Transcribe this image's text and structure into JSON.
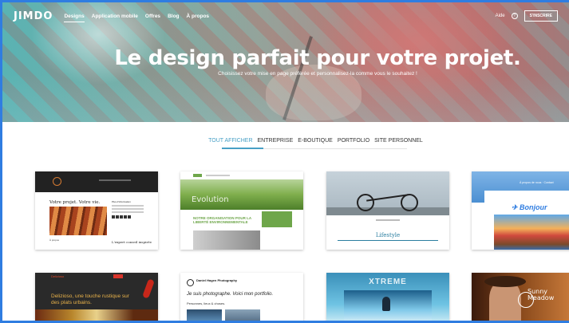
{
  "nav": {
    "logo": "JIMDO",
    "links": [
      "Designs",
      "Application mobile",
      "Offres",
      "Blog",
      "À propos"
    ],
    "help": "Aide",
    "signup": "S'INSCRIRE"
  },
  "hero": {
    "title": "Le design parfait pour votre projet.",
    "subtitle": "Choisissez votre mise en page préférée et personnalisez-la comme vous le souhaitez !"
  },
  "filters": [
    "TOUT AFFICHER",
    "ENTREPRISE",
    "E-BOUTIQUE",
    "PORTFOLIO",
    "SITE PERSONNEL"
  ],
  "cards": {
    "c1": {
      "heading": "Votre projet. Votre vie.",
      "side_title": "Plus d'information",
      "apropos": "À propos",
      "sub": "L'expert conseil inspirée"
    },
    "c2": {
      "overlay": "Evolution",
      "text": "NOTRE ORGANISATION POUR LA LIBERTÉ ENVIRONNEMENTALE"
    },
    "c3": {
      "title": "Lifestyle"
    },
    "c4": {
      "nav": "À propos de nous · Contact",
      "title": "✈ Bonjour"
    },
    "c5": {
      "logo": "Delizioso",
      "text": "Delizioso, une touche rustique sur des plats urbains."
    },
    "c6": {
      "name": "Daniel Hagen Photography",
      "heading": "Je suis photographe. Voici mon portfolio.",
      "sub": "Personnes, lieux & choses."
    },
    "c7": {
      "title": "XTREME"
    },
    "c8": {
      "title": "Sunny Meadow"
    }
  },
  "colors": {
    "accent": "#48a0c6",
    "frame": "#2f7de1",
    "brand_green": "#6ea64a"
  }
}
